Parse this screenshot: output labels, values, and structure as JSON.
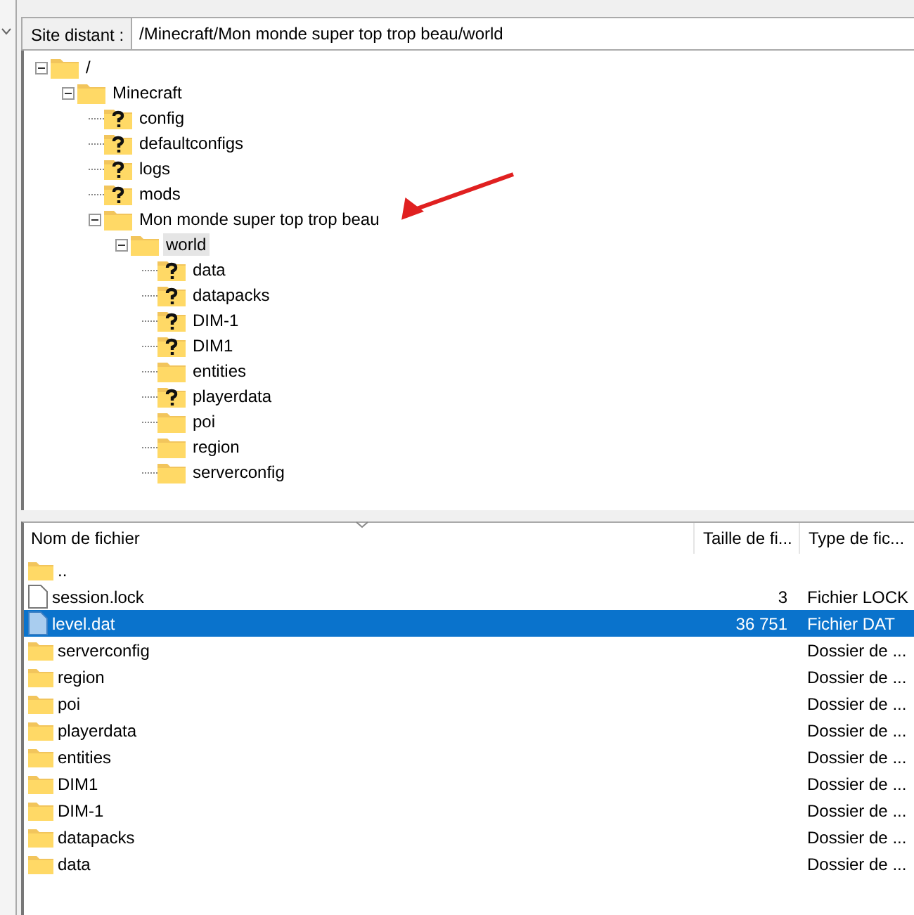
{
  "remote_site": {
    "label": "Site distant :",
    "path": "/Minecraft/Mon monde super top trop beau/world"
  },
  "tree": [
    {
      "name": "/",
      "kind": "folder",
      "expanded": true,
      "selected": false,
      "children": [
        {
          "name": "Minecraft",
          "kind": "folder",
          "expanded": true,
          "selected": false,
          "children": [
            {
              "name": "config",
              "kind": "unknown",
              "selected": false
            },
            {
              "name": "defaultconfigs",
              "kind": "unknown",
              "selected": false
            },
            {
              "name": "logs",
              "kind": "unknown",
              "selected": false
            },
            {
              "name": "mods",
              "kind": "unknown",
              "selected": false
            },
            {
              "name": "Mon monde super top trop beau",
              "kind": "folder",
              "expanded": true,
              "selected": false,
              "children": [
                {
                  "name": "world",
                  "kind": "folder",
                  "expanded": true,
                  "selected": true,
                  "children": [
                    {
                      "name": "data",
                      "kind": "unknown",
                      "selected": false
                    },
                    {
                      "name": "datapacks",
                      "kind": "unknown",
                      "selected": false
                    },
                    {
                      "name": "DIM-1",
                      "kind": "unknown",
                      "selected": false
                    },
                    {
                      "name": "DIM1",
                      "kind": "unknown",
                      "selected": false
                    },
                    {
                      "name": "entities",
                      "kind": "folder",
                      "selected": false
                    },
                    {
                      "name": "playerdata",
                      "kind": "unknown",
                      "selected": false
                    },
                    {
                      "name": "poi",
                      "kind": "folder",
                      "selected": false
                    },
                    {
                      "name": "region",
                      "kind": "folder",
                      "selected": false
                    },
                    {
                      "name": "serverconfig",
                      "kind": "folder",
                      "selected": false
                    }
                  ]
                }
              ]
            }
          ]
        }
      ]
    }
  ],
  "file_list": {
    "columns": [
      "Nom de fichier",
      "Taille de fi...",
      "Type de fic..."
    ],
    "rows": [
      {
        "kind": "folder",
        "name": "..",
        "selected": false
      },
      {
        "kind": "file",
        "name": "session.lock",
        "size": "3",
        "type": "Fichier LOCK",
        "selected": false
      },
      {
        "kind": "datfile",
        "name": "level.dat",
        "size": "36 751",
        "type": "Fichier DAT",
        "selected": true
      },
      {
        "kind": "folder",
        "name": "serverconfig",
        "type": "Dossier de ...",
        "selected": false
      },
      {
        "kind": "folder",
        "name": "region",
        "type": "Dossier de ...",
        "selected": false
      },
      {
        "kind": "folder",
        "name": "poi",
        "type": "Dossier de ...",
        "selected": false
      },
      {
        "kind": "folder",
        "name": "playerdata",
        "type": "Dossier de ...",
        "selected": false
      },
      {
        "kind": "folder",
        "name": "entities",
        "type": "Dossier de ...",
        "selected": false
      },
      {
        "kind": "folder",
        "name": "DIM1",
        "type": "Dossier de ...",
        "selected": false
      },
      {
        "kind": "folder",
        "name": "DIM-1",
        "type": "Dossier de ...",
        "selected": false
      },
      {
        "kind": "folder",
        "name": "datapacks",
        "type": "Dossier de ...",
        "selected": false
      },
      {
        "kind": "folder",
        "name": "data",
        "type": "Dossier de ...",
        "selected": false
      }
    ]
  }
}
